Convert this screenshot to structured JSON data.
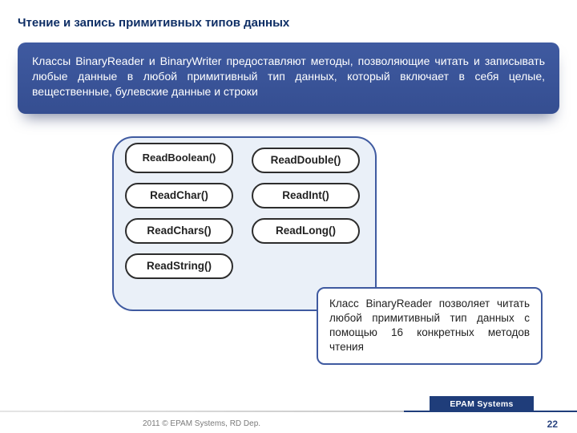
{
  "title": "Чтение и запись примитивных типов данных",
  "intro": "Классы BinaryReader и BinaryWriter предоставляют методы, позволяющие читать и записывать любые данные в любой примитивный тип данных, который включает в себя целые, вещественные, булевские данные и строки",
  "methods": {
    "col1": [
      "ReadBoolean()",
      "ReadChar()",
      "ReadChars()",
      "ReadString()"
    ],
    "col2": [
      "ReadDouble()",
      "ReadInt()",
      "ReadLong()"
    ]
  },
  "note": "Класс BinaryReader позволяет читать любой примитивный тип данных с помощью 16 конкретных методов чтения",
  "footer": {
    "brand": "EPAM Systems",
    "copy": "2011 © EPAM Systems, RD Dep.",
    "page": "22"
  }
}
